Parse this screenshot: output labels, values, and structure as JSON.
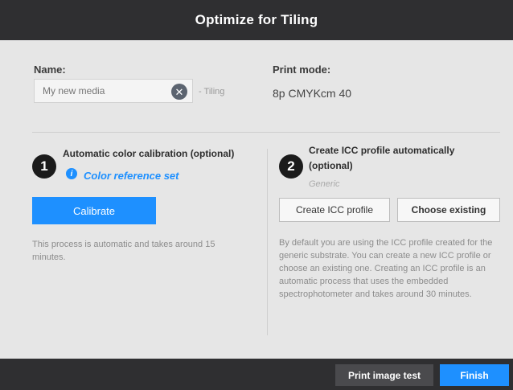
{
  "dialog": {
    "title": "Optimize for Tiling"
  },
  "name_section": {
    "label": "Name:",
    "input_value": "",
    "input_placeholder": "My new media",
    "clear_icon": "close-circle-icon",
    "suffix": "- Tiling"
  },
  "print_mode": {
    "label": "Print mode:",
    "value": "8p CMYKcm 40"
  },
  "step1": {
    "number": "1",
    "title": "Automatic color calibration (optional)",
    "info_icon": "info-icon",
    "info_glyph": "i",
    "link": "Color reference set",
    "button": "Calibrate",
    "description": "This process is automatic and takes around 15 minutes."
  },
  "step2": {
    "number": "2",
    "title": "Create ICC profile automatically (optional)",
    "subtitle": "Generic",
    "create_button": "Create ICC profile",
    "choose_button": "Choose existing",
    "description": "By default you are using the ICC profile created for the generic substrate. You can create a new ICC profile or choose an existing one. Creating an ICC profile is an automatic process that uses the embedded spectrophotometer and takes around 30 minutes."
  },
  "footer": {
    "print_test_button": "Print image test",
    "finish_button": "Finish"
  },
  "colors": {
    "accent": "#1e90ff",
    "titlebar": "#2f2f31",
    "panel": "#e6e6e6"
  }
}
